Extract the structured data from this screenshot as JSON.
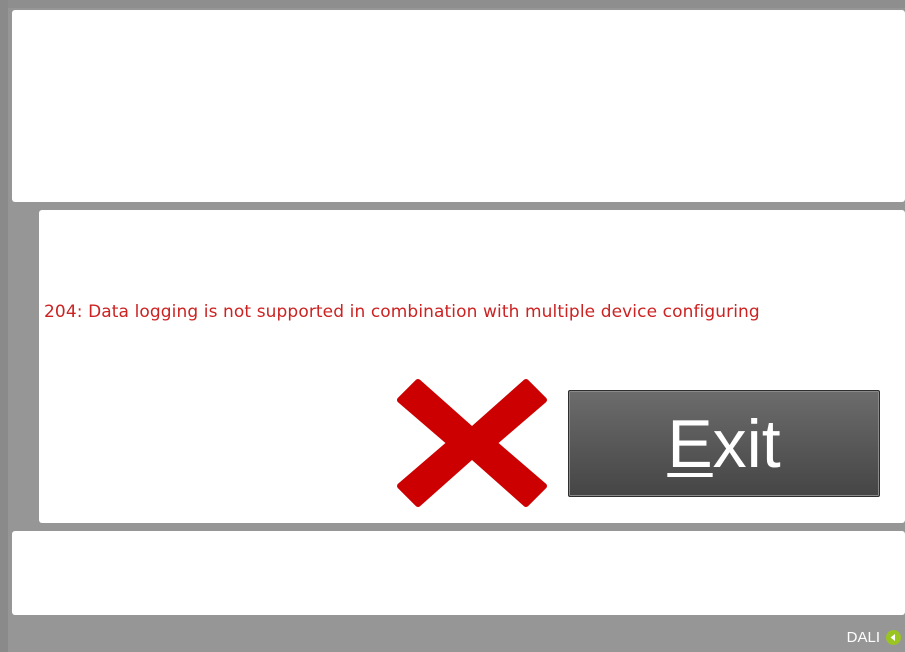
{
  "message": {
    "error_text": "204: Data logging is not supported in combination with multiple device configuring"
  },
  "exit_button": {
    "label_mnemonic": "E",
    "label_rest": "xit"
  },
  "status": {
    "label": "DALI",
    "icon": "connection-indicator-icon",
    "icon_color": "#9ac520"
  },
  "colors": {
    "error_text": "#cc2222",
    "error_icon": "#cc0000",
    "background": "#969696"
  }
}
